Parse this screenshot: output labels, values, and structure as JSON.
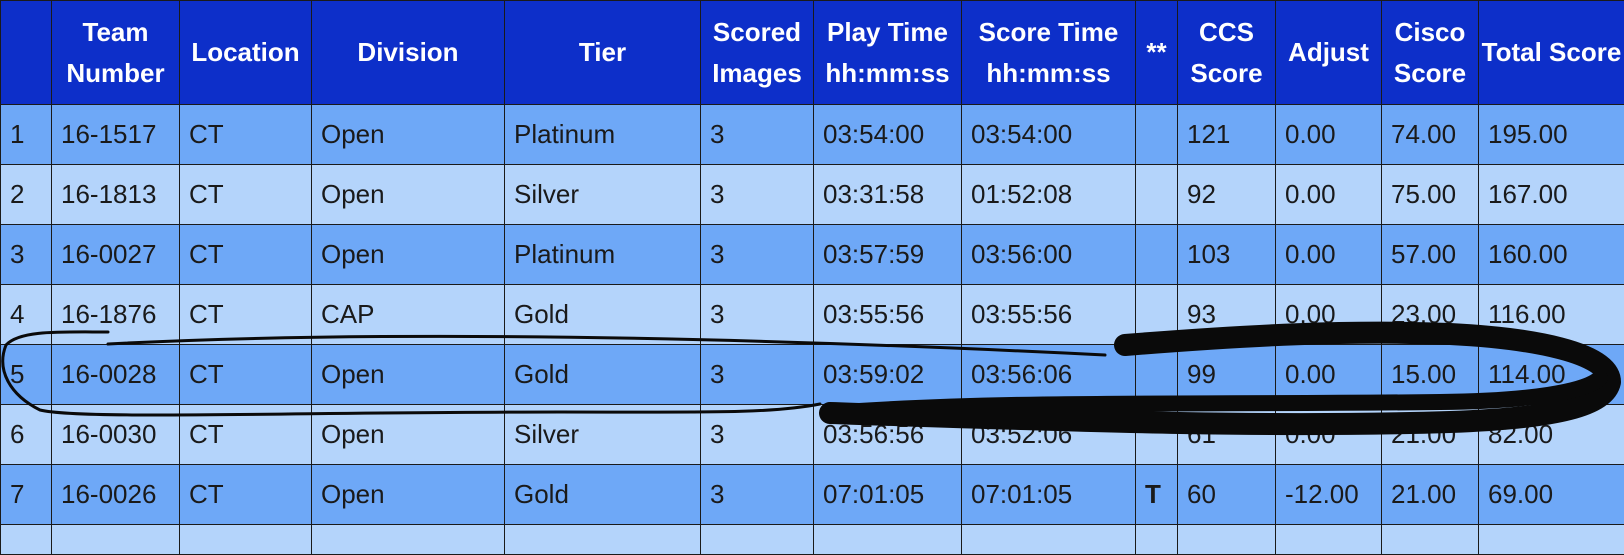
{
  "columns": [
    {
      "key": "rank",
      "label": ""
    },
    {
      "key": "team",
      "label": "Team Number"
    },
    {
      "key": "location",
      "label": "Location"
    },
    {
      "key": "division",
      "label": "Division"
    },
    {
      "key": "tier",
      "label": "Tier"
    },
    {
      "key": "scored_images",
      "label": "Scored Images"
    },
    {
      "key": "play_time",
      "label": "Play Time hh:mm:ss"
    },
    {
      "key": "score_time",
      "label": "Score Time hh:mm:ss"
    },
    {
      "key": "flag",
      "label": "**"
    },
    {
      "key": "ccs_score",
      "label": "CCS Score"
    },
    {
      "key": "adjust",
      "label": "Adjust"
    },
    {
      "key": "cisco_score",
      "label": "Cisco Score"
    },
    {
      "key": "total_score",
      "label": "Total Score"
    }
  ],
  "rows": [
    {
      "rank": "1",
      "team": "16-1517",
      "location": "CT",
      "division": "Open",
      "tier": "Platinum",
      "scored_images": "3",
      "play_time": "03:54:00",
      "score_time": "03:54:00",
      "flag": "",
      "ccs_score": "121",
      "adjust": "0.00",
      "cisco_score": "74.00",
      "total_score": "195.00"
    },
    {
      "rank": "2",
      "team": "16-1813",
      "location": "CT",
      "division": "Open",
      "tier": "Silver",
      "scored_images": "3",
      "play_time": "03:31:58",
      "score_time": "01:52:08",
      "flag": "",
      "ccs_score": "92",
      "adjust": "0.00",
      "cisco_score": "75.00",
      "total_score": "167.00"
    },
    {
      "rank": "3",
      "team": "16-0027",
      "location": "CT",
      "division": "Open",
      "tier": "Platinum",
      "scored_images": "3",
      "play_time": "03:57:59",
      "score_time": "03:56:00",
      "flag": "",
      "ccs_score": "103",
      "adjust": "0.00",
      "cisco_score": "57.00",
      "total_score": "160.00"
    },
    {
      "rank": "4",
      "team": "16-1876",
      "location": "CT",
      "division": "CAP",
      "tier": "Gold",
      "scored_images": "3",
      "play_time": "03:55:56",
      "score_time": "03:55:56",
      "flag": "",
      "ccs_score": "93",
      "adjust": "0.00",
      "cisco_score": "23.00",
      "total_score": "116.00"
    },
    {
      "rank": "5",
      "team": "16-0028",
      "location": "CT",
      "division": "Open",
      "tier": "Gold",
      "scored_images": "3",
      "play_time": "03:59:02",
      "score_time": "03:56:06",
      "flag": "",
      "ccs_score": "99",
      "adjust": "0.00",
      "cisco_score": "15.00",
      "total_score": "114.00"
    },
    {
      "rank": "6",
      "team": "16-0030",
      "location": "CT",
      "division": "Open",
      "tier": "Silver",
      "scored_images": "3",
      "play_time": "03:56:56",
      "score_time": "03:52:06",
      "flag": "",
      "ccs_score": "61",
      "adjust": "0.00",
      "cisco_score": "21.00",
      "total_score": "82.00"
    },
    {
      "rank": "7",
      "team": "16-0026",
      "location": "CT",
      "division": "Open",
      "tier": "Gold",
      "scored_images": "3",
      "play_time": "07:01:05",
      "score_time": "07:01:05",
      "flag": "T",
      "ccs_score": "60",
      "adjust": "-12.00",
      "cisco_score": "21.00",
      "total_score": "69.00"
    }
  ],
  "colors": {
    "header_bg": "#0d2fc9",
    "row_dark": "#6ea8f7",
    "row_light": "#b4d4fb",
    "ink": "#0a0a0a"
  }
}
